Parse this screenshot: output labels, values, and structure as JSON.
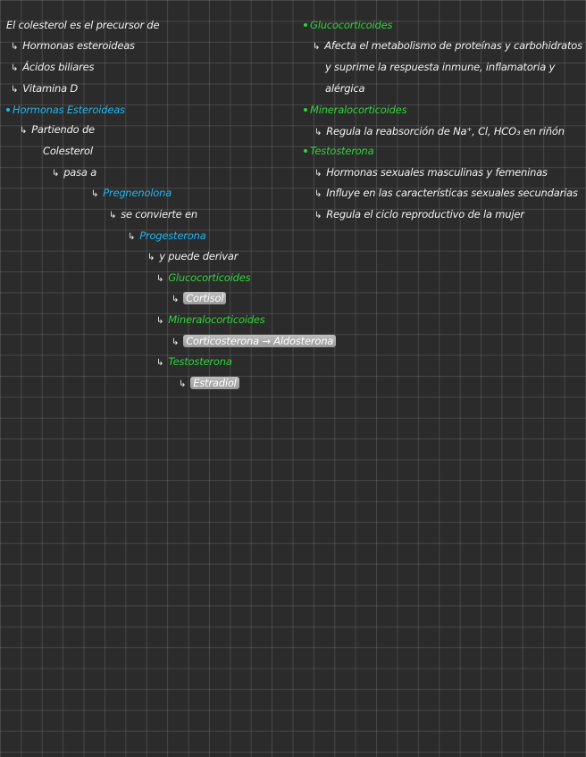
{
  "left": {
    "intro": "El colesterol es el precursor de",
    "items": [
      "Hormonas esteroideas",
      "Ácidos biliares",
      "Vitamina D"
    ],
    "section_title": "Hormonas Esteroideas",
    "partiendo": "Partiendo de",
    "colesterol": "Colesterol",
    "pasa_a": "pasa a",
    "pregnenolona": "Pregnenolona",
    "se_convierte": "se convierte en",
    "progesterona": "Progesterona",
    "puede_derivar": "y puede derivar",
    "glucocorticoides": "Glucocorticoides",
    "cortisol": "Cortisol",
    "mineralocorticoides": "Mineralocorticoides",
    "corticosterona": "Corticosterona → Aldosterona",
    "testosterona": "Testosterona",
    "estradiol": "Estradiol"
  },
  "right": {
    "gluco_title": "Glucocorticoides",
    "gluco_line1": "Afecta el metabolismo de proteínas y carbohidratos",
    "gluco_line2": "y suprime la respuesta inmune, inflamatoria y",
    "gluco_line3": "alérgica",
    "mineral_title": "Mineralocorticoides",
    "mineral_line1": "Regula la reabsorción de Na⁺, Cl, HCO₃ en riñón",
    "testo_title": "Testosterona",
    "testo_line1": "Hormonas sexuales masculinas y femeninas",
    "testo_line2": "Influye en las características sexuales secundarias",
    "testo_line3": "Regula el ciclo reproductivo de la mujer"
  },
  "colors": {
    "background": "#2b2b2b",
    "grid": "#4a4a4a",
    "text": "#f2f2f2",
    "cyan": "#1fb6f0",
    "green": "#2fd33a"
  },
  "icons": {
    "arrow": "↳",
    "bullet": "•"
  }
}
